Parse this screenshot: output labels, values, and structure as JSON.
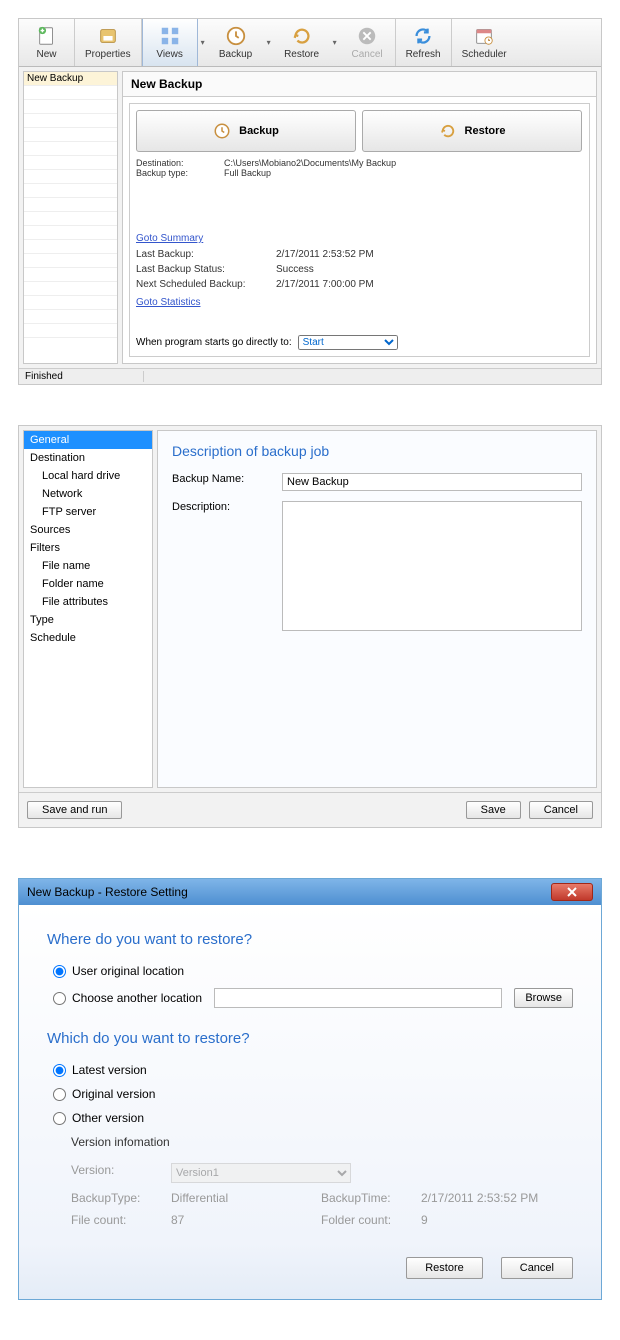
{
  "toolbar": {
    "new": "New",
    "properties": "Properties",
    "views": "Views",
    "backup": "Backup",
    "restore": "Restore",
    "cancel": "Cancel",
    "refresh": "Refresh",
    "scheduler": "Scheduler"
  },
  "leftlist": {
    "item0": "New Backup"
  },
  "main": {
    "title": "New Backup",
    "backup_btn": "Backup",
    "restore_btn": "Restore",
    "dest_label": "Destination:",
    "dest_value": "C:\\Users\\Mobiano2\\Documents\\My Backup",
    "type_label": "Backup type:",
    "type_value": "Full Backup",
    "goto_summary": "Goto Summary",
    "last_backup_label": "Last Backup:",
    "last_backup_value": "2/17/2011 2:53:52 PM",
    "last_status_label": "Last Backup Status:",
    "last_status_value": "Success",
    "next_label": "Next Scheduled Backup:",
    "next_value": "2/17/2011 7:00:00 PM",
    "goto_stats": "Goto Statistics",
    "startlabel": "When program starts go directly to:",
    "start_value": "Start"
  },
  "status": {
    "left": "Finished",
    "mid": ""
  },
  "p2": {
    "nav": {
      "general": "General",
      "destination": "Destination",
      "lhd": "Local hard drive",
      "network": "Network",
      "ftp": "FTP server",
      "sources": "Sources",
      "filters": "Filters",
      "fname": "File name",
      "foldname": "Folder name",
      "fattr": "File attributes",
      "type": "Type",
      "schedule": "Schedule"
    },
    "head": "Description of backup job",
    "name_label": "Backup Name:",
    "name_value": "New Backup",
    "desc_label": "Description:",
    "save_run": "Save and run",
    "save": "Save",
    "cancel": "Cancel"
  },
  "p3": {
    "title": "New Backup - Restore Setting",
    "where_head": "Where do you want to restore?",
    "orig_loc": "User original location",
    "choose_loc": "Choose another location",
    "browse": "Browse",
    "which_head": "Which do you want to restore?",
    "latest": "Latest version",
    "original": "Original version",
    "other": "Other version",
    "vi_title": "Version infomation",
    "vi_version_label": "Version:",
    "vi_version_value": "Version1",
    "vi_btype_label": "BackupType:",
    "vi_btype_value": "Differential",
    "vi_btime_label": "BackupTime:",
    "vi_btime_value": "2/17/2011 2:53:52 PM",
    "vi_fcount_label": "File count:",
    "vi_fcount_value": "87",
    "vi_foldcount_label": "Folder count:",
    "vi_foldcount_value": "9",
    "restore_btn": "Restore",
    "cancel_btn": "Cancel"
  }
}
